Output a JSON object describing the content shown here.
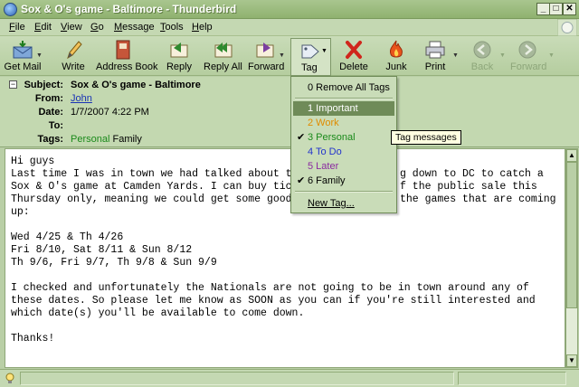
{
  "window": {
    "title": "Sox & O's game - Baltimore - Thunderbird",
    "minimize": "_",
    "maximize": "□",
    "close": "✕"
  },
  "menubar": [
    {
      "label": "File",
      "mnemonic": "F",
      "rest": "ile"
    },
    {
      "label": "Edit",
      "mnemonic": "E",
      "rest": "dit"
    },
    {
      "label": "View",
      "mnemonic": "V",
      "rest": "iew"
    },
    {
      "label": "Go",
      "mnemonic": "G",
      "rest": "o"
    },
    {
      "label": "Message",
      "mnemonic": "M",
      "rest": "essage"
    },
    {
      "label": "Tools",
      "mnemonic": "T",
      "rest": "ools"
    },
    {
      "label": "Help",
      "mnemonic": "H",
      "rest": "elp"
    }
  ],
  "toolbar": {
    "get_mail": "Get Mail",
    "write": "Write",
    "address_book": "Address Book",
    "reply": "Reply",
    "reply_all": "Reply All",
    "forward": "Forward",
    "tag": "Tag",
    "delete": "Delete",
    "junk": "Junk",
    "print": "Print",
    "back": "Back",
    "forward_nav": "Forward"
  },
  "headers": {
    "collapse": "−",
    "subject_label": "Subject:",
    "subject": "Sox & O's game - Baltimore",
    "from_label": "From:",
    "from": "John",
    "date_label": "Date:",
    "date": "1/7/2007 4:22 PM",
    "to_label": "To:",
    "to": "",
    "tags_label": "Tags:",
    "tag1": "Personal",
    "tag2": "Family"
  },
  "body_lines": [
    "Hi guys",
    "Last time I was in town we had talked about th",
    "Sox & O's game at Camden Yards. I can buy tick",
    "Thursday only, meaning we could get some good",
    "up:",
    "",
    "Wed 4/25 & Th 4/26",
    "Fri 8/10, Sat 8/11 & Sun 8/12",
    "Th 9/6, Fri 9/7, Th 9/8 & Sun 9/9",
    "",
    "I checked and unfortunately the Nationals are not going to be in town around any of",
    "these dates. So please let me know as SOON as you can if you're still interested and",
    "which date(s) you'll be available to come down.",
    "",
    "Thanks!"
  ],
  "body_fragments": {
    "line1_tail": "g down to DC to catch a",
    "line2_tail": "f the public sale this",
    "line3_tail": "the games that are coming"
  },
  "tag_menu": {
    "remove_all": "0 Remove All Tags",
    "items": [
      {
        "label": "1 Important",
        "checked": false,
        "color": "#ffffff"
      },
      {
        "label": "2 Work",
        "checked": false,
        "color": "#e08c00"
      },
      {
        "label": "3 Personal",
        "checked": true,
        "color": "#1b8a1b"
      },
      {
        "label": "4 To Do",
        "checked": false,
        "color": "#2233cc"
      },
      {
        "label": "5 Later",
        "checked": false,
        "color": "#8a2aa0"
      },
      {
        "label": "6 Family",
        "checked": true,
        "color": "#000000"
      }
    ],
    "new_tag": "New Tag..."
  },
  "tooltip": "Tag messages",
  "colors": {
    "tag_personal": "#1b8a1b",
    "link": "#1a33b5",
    "chrome_green": "#b9cfa6"
  }
}
